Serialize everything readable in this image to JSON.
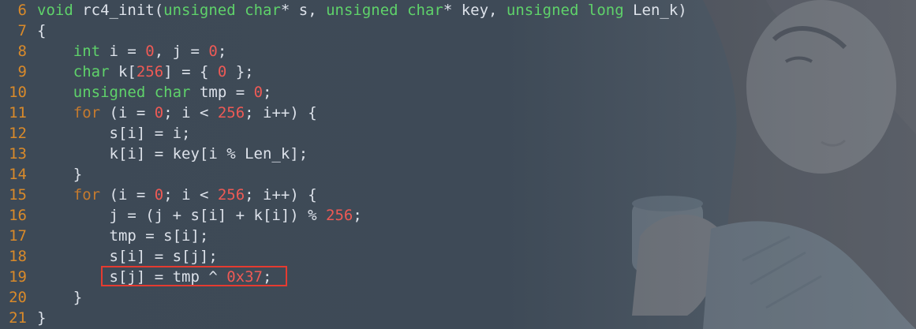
{
  "editor": {
    "lines": [
      {
        "number": "6",
        "tokens": [
          {
            "text": "void",
            "kind": "type"
          },
          {
            "text": " rc4_init(",
            "kind": "id"
          },
          {
            "text": "unsigned",
            "kind": "type"
          },
          {
            "text": " ",
            "kind": "id"
          },
          {
            "text": "char",
            "kind": "type"
          },
          {
            "text": "* s, ",
            "kind": "id"
          },
          {
            "text": "unsigned",
            "kind": "type"
          },
          {
            "text": " ",
            "kind": "id"
          },
          {
            "text": "char",
            "kind": "type"
          },
          {
            "text": "* key, ",
            "kind": "id"
          },
          {
            "text": "unsigned",
            "kind": "type"
          },
          {
            "text": " ",
            "kind": "id"
          },
          {
            "text": "long",
            "kind": "type"
          },
          {
            "text": " Len_k)",
            "kind": "id"
          }
        ]
      },
      {
        "number": "7",
        "tokens": [
          {
            "text": "{",
            "kind": "id"
          }
        ]
      },
      {
        "number": "8",
        "tokens": [
          {
            "text": "    ",
            "kind": "id"
          },
          {
            "text": "int",
            "kind": "type"
          },
          {
            "text": " i = ",
            "kind": "id"
          },
          {
            "text": "0",
            "kind": "num"
          },
          {
            "text": ", j = ",
            "kind": "id"
          },
          {
            "text": "0",
            "kind": "num"
          },
          {
            "text": ";",
            "kind": "id"
          }
        ]
      },
      {
        "number": "9",
        "tokens": [
          {
            "text": "    ",
            "kind": "id"
          },
          {
            "text": "char",
            "kind": "type"
          },
          {
            "text": " k[",
            "kind": "id"
          },
          {
            "text": "256",
            "kind": "num"
          },
          {
            "text": "] = { ",
            "kind": "id"
          },
          {
            "text": "0",
            "kind": "num"
          },
          {
            "text": " };",
            "kind": "id"
          }
        ]
      },
      {
        "number": "10",
        "tokens": [
          {
            "text": "    ",
            "kind": "id"
          },
          {
            "text": "unsigned",
            "kind": "type"
          },
          {
            "text": " ",
            "kind": "id"
          },
          {
            "text": "char",
            "kind": "type"
          },
          {
            "text": " tmp = ",
            "kind": "id"
          },
          {
            "text": "0",
            "kind": "num"
          },
          {
            "text": ";",
            "kind": "id"
          }
        ]
      },
      {
        "number": "11",
        "tokens": [
          {
            "text": "    ",
            "kind": "id"
          },
          {
            "text": "for",
            "kind": "kw"
          },
          {
            "text": " (i = ",
            "kind": "id"
          },
          {
            "text": "0",
            "kind": "num"
          },
          {
            "text": "; i < ",
            "kind": "id"
          },
          {
            "text": "256",
            "kind": "num"
          },
          {
            "text": "; i++) {",
            "kind": "id"
          }
        ]
      },
      {
        "number": "12",
        "tokens": [
          {
            "text": "        s[i] = i;",
            "kind": "id"
          }
        ]
      },
      {
        "number": "13",
        "tokens": [
          {
            "text": "        k[i] = key[i % Len_k];",
            "kind": "id"
          }
        ]
      },
      {
        "number": "14",
        "tokens": [
          {
            "text": "    }",
            "kind": "id"
          }
        ]
      },
      {
        "number": "15",
        "tokens": [
          {
            "text": "    ",
            "kind": "id"
          },
          {
            "text": "for",
            "kind": "kw"
          },
          {
            "text": " (i = ",
            "kind": "id"
          },
          {
            "text": "0",
            "kind": "num"
          },
          {
            "text": "; i < ",
            "kind": "id"
          },
          {
            "text": "256",
            "kind": "num"
          },
          {
            "text": "; i++) {",
            "kind": "id"
          }
        ]
      },
      {
        "number": "16",
        "tokens": [
          {
            "text": "        j = (j + s[i] + k[i]) % ",
            "kind": "id"
          },
          {
            "text": "256",
            "kind": "num"
          },
          {
            "text": ";",
            "kind": "id"
          }
        ]
      },
      {
        "number": "17",
        "tokens": [
          {
            "text": "        tmp = s[i];",
            "kind": "id"
          }
        ]
      },
      {
        "number": "18",
        "tokens": [
          {
            "text": "        s[i] = s[j];",
            "kind": "id"
          }
        ]
      },
      {
        "number": "19",
        "tokens": [
          {
            "text": "        s[j] = tmp ^ ",
            "kind": "id"
          },
          {
            "text": "0x37",
            "kind": "num"
          },
          {
            "text": ";",
            "kind": "id"
          }
        ]
      },
      {
        "number": "20",
        "tokens": [
          {
            "text": "    }",
            "kind": "id"
          }
        ]
      },
      {
        "number": "21",
        "tokens": [
          {
            "text": "}",
            "kind": "id"
          }
        ]
      }
    ],
    "highlighted_line": "19",
    "colors": {
      "background": "#3e4a57",
      "line_number": "#d98a2a",
      "type_keyword": "#5fd26a",
      "control_keyword": "#c57a2e",
      "number_literal": "#ee5a55",
      "identifier": "#dde2ea",
      "highlight_border": "#e53b30"
    }
  }
}
